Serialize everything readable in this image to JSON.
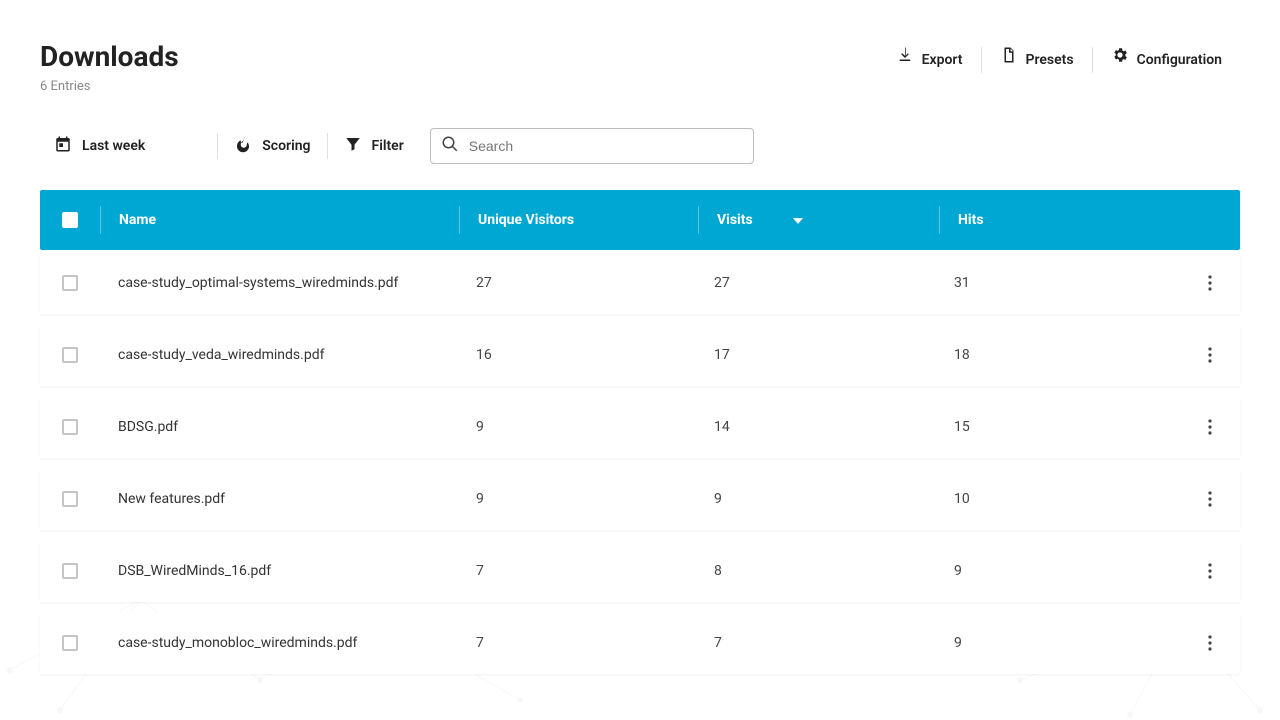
{
  "header": {
    "title": "Downloads",
    "entries_label": "6 Entries",
    "actions": {
      "export": "Export",
      "presets": "Presets",
      "configuration": "Configuration"
    }
  },
  "toolbar": {
    "date_range": "Last week",
    "scoring": "Scoring",
    "filter": "Filter",
    "search_placeholder": "Search"
  },
  "table": {
    "columns": {
      "name": "Name",
      "unique_visitors": "Unique Visitors",
      "visits": "Visits",
      "hits": "Hits"
    },
    "sorted_by": "visits",
    "sort_direction": "desc",
    "rows": [
      {
        "name": "case-study_optimal-systems_wiredminds.pdf",
        "unique_visitors": "27",
        "visits": "27",
        "hits": "31"
      },
      {
        "name": "case-study_veda_wiredminds.pdf",
        "unique_visitors": "16",
        "visits": "17",
        "hits": "18"
      },
      {
        "name": "BDSG.pdf",
        "unique_visitors": "9",
        "visits": "14",
        "hits": "15"
      },
      {
        "name": "New features.pdf",
        "unique_visitors": "9",
        "visits": "9",
        "hits": "10"
      },
      {
        "name": "DSB_WiredMinds_16.pdf",
        "unique_visitors": "7",
        "visits": "8",
        "hits": "9"
      },
      {
        "name": "case-study_monobloc_wiredminds.pdf",
        "unique_visitors": "7",
        "visits": "7",
        "hits": "9"
      }
    ]
  }
}
